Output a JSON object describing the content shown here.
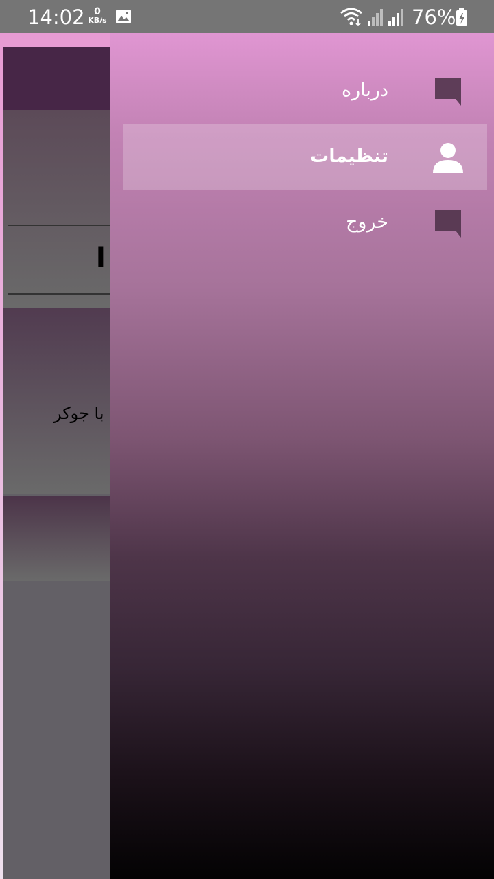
{
  "status_bar": {
    "time": "14:02",
    "net_speed_value": "0",
    "net_speed_unit": "KB/s",
    "battery_percent": "76%",
    "icons": [
      "image-icon",
      "wifi-icon",
      "signal-icon",
      "signal-icon",
      "battery-charging-icon"
    ]
  },
  "background_app": {
    "heading_fragment": "ا",
    "text_fragment": "با جوکر"
  },
  "drawer": {
    "items": [
      {
        "label": "درباره",
        "icon": "chat-bubble-icon",
        "active": false
      },
      {
        "label": "تنظیمات",
        "icon": "person-icon",
        "active": true
      },
      {
        "label": "خروج",
        "icon": "chat-bubble-icon",
        "active": false
      }
    ]
  },
  "colors": {
    "status_bar": "#757575",
    "toolbar": "#472647",
    "drawer_top": "#e096d2",
    "drawer_bottom": "#030203",
    "icon_dark": "#5e3d58"
  }
}
